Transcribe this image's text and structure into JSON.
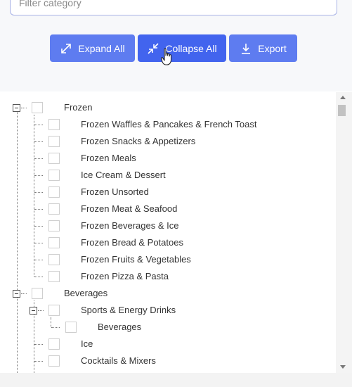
{
  "filter": {
    "placeholder": "Filter category"
  },
  "toolbar": {
    "expand_all": "Expand All",
    "collapse_all": "Collapse All",
    "export": "Export"
  },
  "tree": {
    "frozen": {
      "label": "Frozen",
      "children": [
        "Frozen Waffles & Pancakes & French Toast",
        "Frozen Snacks & Appetizers",
        "Frozen Meals",
        "Ice Cream & Dessert",
        "Frozen Unsorted",
        "Frozen Meat & Seafood",
        "Frozen Beverages & Ice",
        "Frozen Bread & Potatoes",
        "Frozen Fruits & Vegetables",
        "Frozen Pizza & Pasta"
      ]
    },
    "beverages": {
      "label": "Beverages",
      "sports_energy": {
        "label": "Sports & Energy Drinks",
        "child": "Beverages"
      },
      "ice": "Ice",
      "cocktails": "Cocktails & Mixers"
    }
  },
  "colors": {
    "button": "#5e7cf0",
    "button_active": "#4264ee"
  }
}
